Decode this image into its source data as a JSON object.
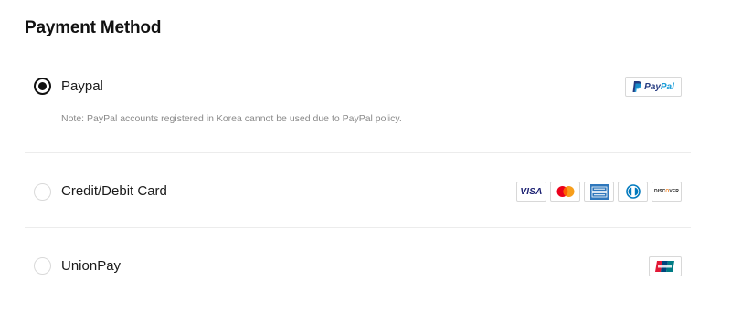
{
  "section": {
    "title": "Payment Method"
  },
  "options": [
    {
      "label": "Paypal",
      "selected": true,
      "note": "Note: PayPal accounts registered in Korea cannot be used due to PayPal policy.",
      "logo_text_pay": "Pay",
      "logo_text_pal": "Pal"
    },
    {
      "label": "Credit/Debit Card",
      "selected": false,
      "logos": {
        "visa": "VISA",
        "discover_pre": "DISC",
        "discover_o": "O",
        "discover_post": "VER"
      }
    },
    {
      "label": "UnionPay",
      "selected": false
    }
  ],
  "colors": {
    "paypal_dark_blue": "#253b80",
    "paypal_light_blue": "#179bd7",
    "visa_blue": "#1a1f71",
    "mastercard_red": "#eb001b",
    "mastercard_orange": "#f79e1b",
    "amex_blue": "#2e77bc",
    "diners_blue": "#0079be",
    "unionpay_red": "#e21836",
    "unionpay_blue": "#00447c",
    "unionpay_teal": "#007b84"
  },
  "icons": {
    "paypal": "paypal-logo",
    "visa": "visa-logo",
    "mastercard": "mastercard-logo",
    "amex": "amex-logo",
    "diners": "diners-club-logo",
    "discover": "discover-logo",
    "unionpay": "unionpay-logo"
  }
}
